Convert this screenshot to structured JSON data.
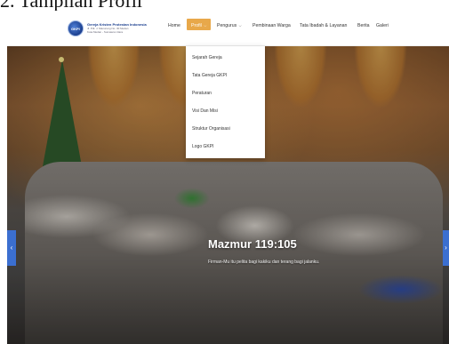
{
  "document": {
    "heading": "2.  Tampilan Profil"
  },
  "brand": {
    "logo_text": "GKPI",
    "title": "Gereja Kristen Protestan Indonesia",
    "subtitle_line1": "Jl. Pdt. J. Manurung No. 30 Medan",
    "subtitle_line2": "Kota Medan - Sumatera Utara"
  },
  "nav": {
    "items": [
      {
        "label": "Home",
        "dropdown": false,
        "active": false
      },
      {
        "label": "Profil",
        "dropdown": true,
        "active": true
      },
      {
        "label": "Pengurus",
        "dropdown": true,
        "active": false
      },
      {
        "label": "Pembinaan Warga",
        "dropdown": false,
        "active": false
      },
      {
        "label": "Tata Ibadah & Layanan",
        "dropdown": false,
        "active": false
      },
      {
        "label": "Berita",
        "dropdown": false,
        "active": false
      },
      {
        "label": "Galeri",
        "dropdown": false,
        "active": false
      }
    ],
    "chevron": "⌵"
  },
  "dropdown": {
    "items": [
      {
        "label": "Sejarah Gereja"
      },
      {
        "label": "Tata Gereja GKPI"
      },
      {
        "label": "Peraturan"
      },
      {
        "label": "Visi Dan Misi"
      },
      {
        "label": "Struktur Organisasi"
      },
      {
        "label": "Logo GKPI"
      }
    ]
  },
  "hero": {
    "title": "Mazmur 119:105",
    "subtitle": "Firman-Mu itu pelita bagi kakiku dan terang bagi jalanku.",
    "prev_icon": "‹",
    "next_icon": "›"
  },
  "colors": {
    "accent": "#e8a84a",
    "brand_blue": "#1b3f8f",
    "slider_arrow": "#3b6fd0"
  }
}
